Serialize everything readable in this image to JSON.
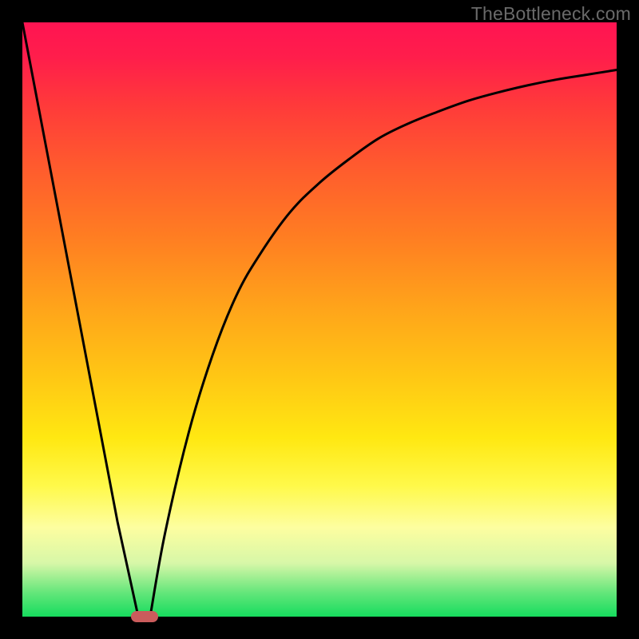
{
  "watermark": "TheBottleneck.com",
  "chart_data": {
    "type": "line",
    "title": "",
    "xlabel": "",
    "ylabel": "",
    "xlim": [
      0,
      100
    ],
    "ylim": [
      0,
      100
    ],
    "grid": false,
    "legend": false,
    "series": [
      {
        "name": "left-branch",
        "x": [
          0,
          4,
          8,
          12,
          16,
          19.5
        ],
        "values": [
          100,
          79,
          58,
          37,
          16,
          0
        ]
      },
      {
        "name": "right-branch",
        "x": [
          21.5,
          24,
          28,
          32,
          36,
          40,
          45,
          50,
          55,
          60,
          65,
          70,
          75,
          80,
          85,
          90,
          95,
          100
        ],
        "values": [
          0,
          14,
          31,
          44,
          54,
          61,
          68,
          73,
          77,
          80.5,
          83,
          85,
          86.8,
          88.2,
          89.4,
          90.4,
          91.2,
          92
        ]
      }
    ],
    "marker": {
      "x": 20.5,
      "y": 0
    },
    "background_gradient": {
      "top": "#ff1452",
      "bottom": "#16dc5e"
    },
    "curve_color": "#000000",
    "marker_color": "#cb5c5c"
  }
}
